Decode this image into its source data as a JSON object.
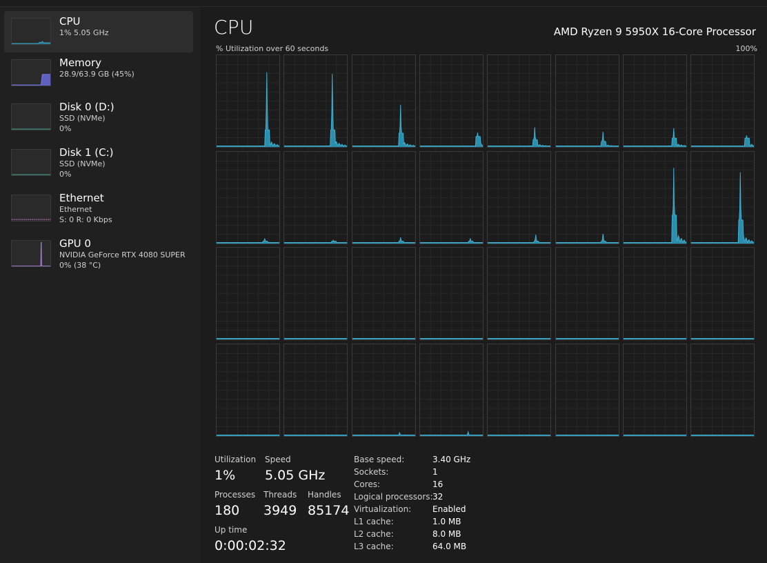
{
  "colors": {
    "cpu_accent": "#41b0d3",
    "cpu_fill": "#2ea3c6",
    "memory_accent": "#7c7ce6",
    "disk_accent": "#4ab8a8",
    "ethernet_accent": "#c77bcf",
    "gpu_accent": "#a87fd8",
    "selected_bg": "#2d2d2d",
    "grid_line": "#2f2f2f"
  },
  "sidebar": {
    "items": [
      {
        "title": "CPU",
        "lines": [
          "1%  5.05 GHz"
        ],
        "icon": "cpu-thumbnail-graph",
        "selected": true
      },
      {
        "title": "Memory",
        "lines": [
          "28.9/63.9 GB (45%)"
        ],
        "icon": "memory-thumbnail-graph",
        "selected": false
      },
      {
        "title": "Disk 0 (D:)",
        "lines": [
          "SSD (NVMe)",
          "0%"
        ],
        "icon": "disk-thumbnail-graph",
        "selected": false
      },
      {
        "title": "Disk 1 (C:)",
        "lines": [
          "SSD (NVMe)",
          "0%"
        ],
        "icon": "disk-thumbnail-graph",
        "selected": false
      },
      {
        "title": "Ethernet",
        "lines": [
          "Ethernet",
          "S: 0 R: 0 Kbps"
        ],
        "icon": "ethernet-thumbnail-graph",
        "selected": false
      },
      {
        "title": "GPU 0",
        "lines": [
          "NVIDIA GeForce RTX 4080 SUPER",
          "0%  (38 °C)"
        ],
        "icon": "gpu-thumbnail-graph",
        "selected": false
      }
    ]
  },
  "main": {
    "title": "CPU",
    "processor": "AMD Ryzen 9 5950X 16-Core Processor",
    "graph_label": "% Utilization over 60 seconds",
    "graph_max": "100%"
  },
  "stats": {
    "utilization_label": "Utilization",
    "utilization_value": "1%",
    "speed_label": "Speed",
    "speed_value": "5.05 GHz",
    "processes_label": "Processes",
    "processes_value": "180",
    "threads_label": "Threads",
    "threads_value": "3949",
    "handles_label": "Handles",
    "handles_value": "85174",
    "uptime_label": "Up time",
    "uptime_value": "0:00:02:32"
  },
  "specs": [
    {
      "key": "Base speed:",
      "value": "3.40 GHz"
    },
    {
      "key": "Sockets:",
      "value": "1"
    },
    {
      "key": "Cores:",
      "value": "16"
    },
    {
      "key": "Logical processors:",
      "value": "32"
    },
    {
      "key": "Virtualization:",
      "value": "Enabled"
    },
    {
      "key": "L1 cache:",
      "value": "1.0 MB"
    },
    {
      "key": "L2 cache:",
      "value": "8.0 MB"
    },
    {
      "key": "L3 cache:",
      "value": "64.0 MB"
    }
  ],
  "chart_data": {
    "type": "area",
    "title": "% Utilization over 60 seconds",
    "x_unit": "seconds",
    "xlim": [
      0,
      60
    ],
    "ylim": [
      0,
      100
    ],
    "grid": true,
    "cores": [
      {
        "peak": 82,
        "peak_x": 48,
        "tail": 10
      },
      {
        "peak": 80,
        "peak_x": 46,
        "tail": 10
      },
      {
        "peak": 46,
        "peak_x": 46,
        "tail": 8
      },
      {
        "peak": 15,
        "peak_x": 55,
        "tail": 6
      },
      {
        "peak": 21,
        "peak_x": 45,
        "tail": 4
      },
      {
        "peak": 16,
        "peak_x": 45,
        "tail": 3
      },
      {
        "peak": 20,
        "peak_x": 48,
        "tail": 5
      },
      {
        "peak": 12,
        "peak_x": 53,
        "tail": 5
      },
      {
        "peak": 5,
        "peak_x": 46,
        "tail": 1
      },
      {
        "peak": 3,
        "peak_x": 47,
        "tail": 1
      },
      {
        "peak": 6,
        "peak_x": 46,
        "tail": 1
      },
      {
        "peak": 5,
        "peak_x": 48,
        "tail": 1
      },
      {
        "peak": 9,
        "peak_x": 46,
        "tail": 1
      },
      {
        "peak": 10,
        "peak_x": 45,
        "tail": 1
      },
      {
        "peak": 83,
        "peak_x": 48,
        "tail": 17
      },
      {
        "peak": 78,
        "peak_x": 47,
        "tail": 14
      },
      {
        "peak": 0,
        "peak_x": 55,
        "tail": 0
      },
      {
        "peak": 0,
        "peak_x": 55,
        "tail": 0
      },
      {
        "peak": 0,
        "peak_x": 55,
        "tail": 0
      },
      {
        "peak": 0,
        "peak_x": 55,
        "tail": 0
      },
      {
        "peak": 0,
        "peak_x": 55,
        "tail": 0
      },
      {
        "peak": 0,
        "peak_x": 55,
        "tail": 0
      },
      {
        "peak": 0,
        "peak_x": 55,
        "tail": 0
      },
      {
        "peak": 0,
        "peak_x": 55,
        "tail": 0
      },
      {
        "peak": 0,
        "peak_x": 55,
        "tail": 0
      },
      {
        "peak": 0,
        "peak_x": 55,
        "tail": 0
      },
      {
        "peak": 3,
        "peak_x": 45,
        "tail": 0
      },
      {
        "peak": 4,
        "peak_x": 46,
        "tail": 0
      },
      {
        "peak": 0,
        "peak_x": 55,
        "tail": 0
      },
      {
        "peak": 0,
        "peak_x": 55,
        "tail": 0
      },
      {
        "peak": 0,
        "peak_x": 55,
        "tail": 0
      },
      {
        "peak": 0,
        "peak_x": 55,
        "tail": 0
      }
    ]
  }
}
